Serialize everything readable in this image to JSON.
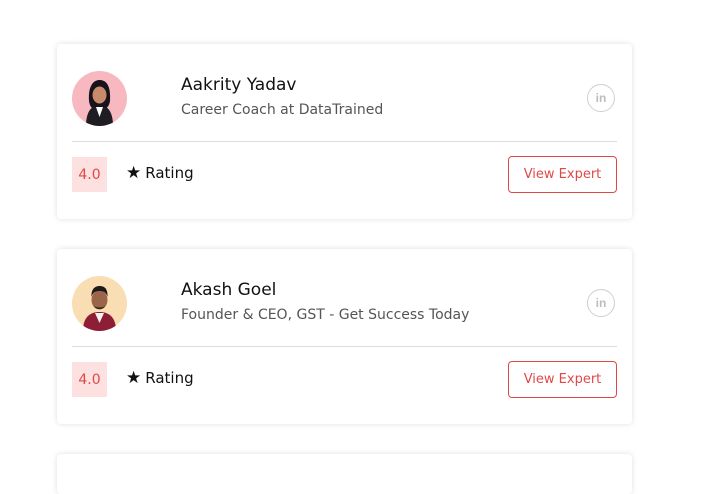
{
  "experts": [
    {
      "name": "Aakrity Yadav",
      "title": "Career Coach at DataTrained",
      "score": "4.0",
      "rating_label": "Rating",
      "button_label": "View Expert",
      "linkedin_glyph": "in",
      "avatar_bg": "#f8b8c0"
    },
    {
      "name": "Akash Goel",
      "title": "Founder & CEO, GST - Get Success Today",
      "score": "4.0",
      "rating_label": "Rating",
      "button_label": "View Expert",
      "linkedin_glyph": "in",
      "avatar_bg": "#f9ddb3"
    }
  ],
  "colors": {
    "accent": "#e04848",
    "score_bg": "#fde0e0"
  },
  "icons": {
    "star": "★"
  }
}
